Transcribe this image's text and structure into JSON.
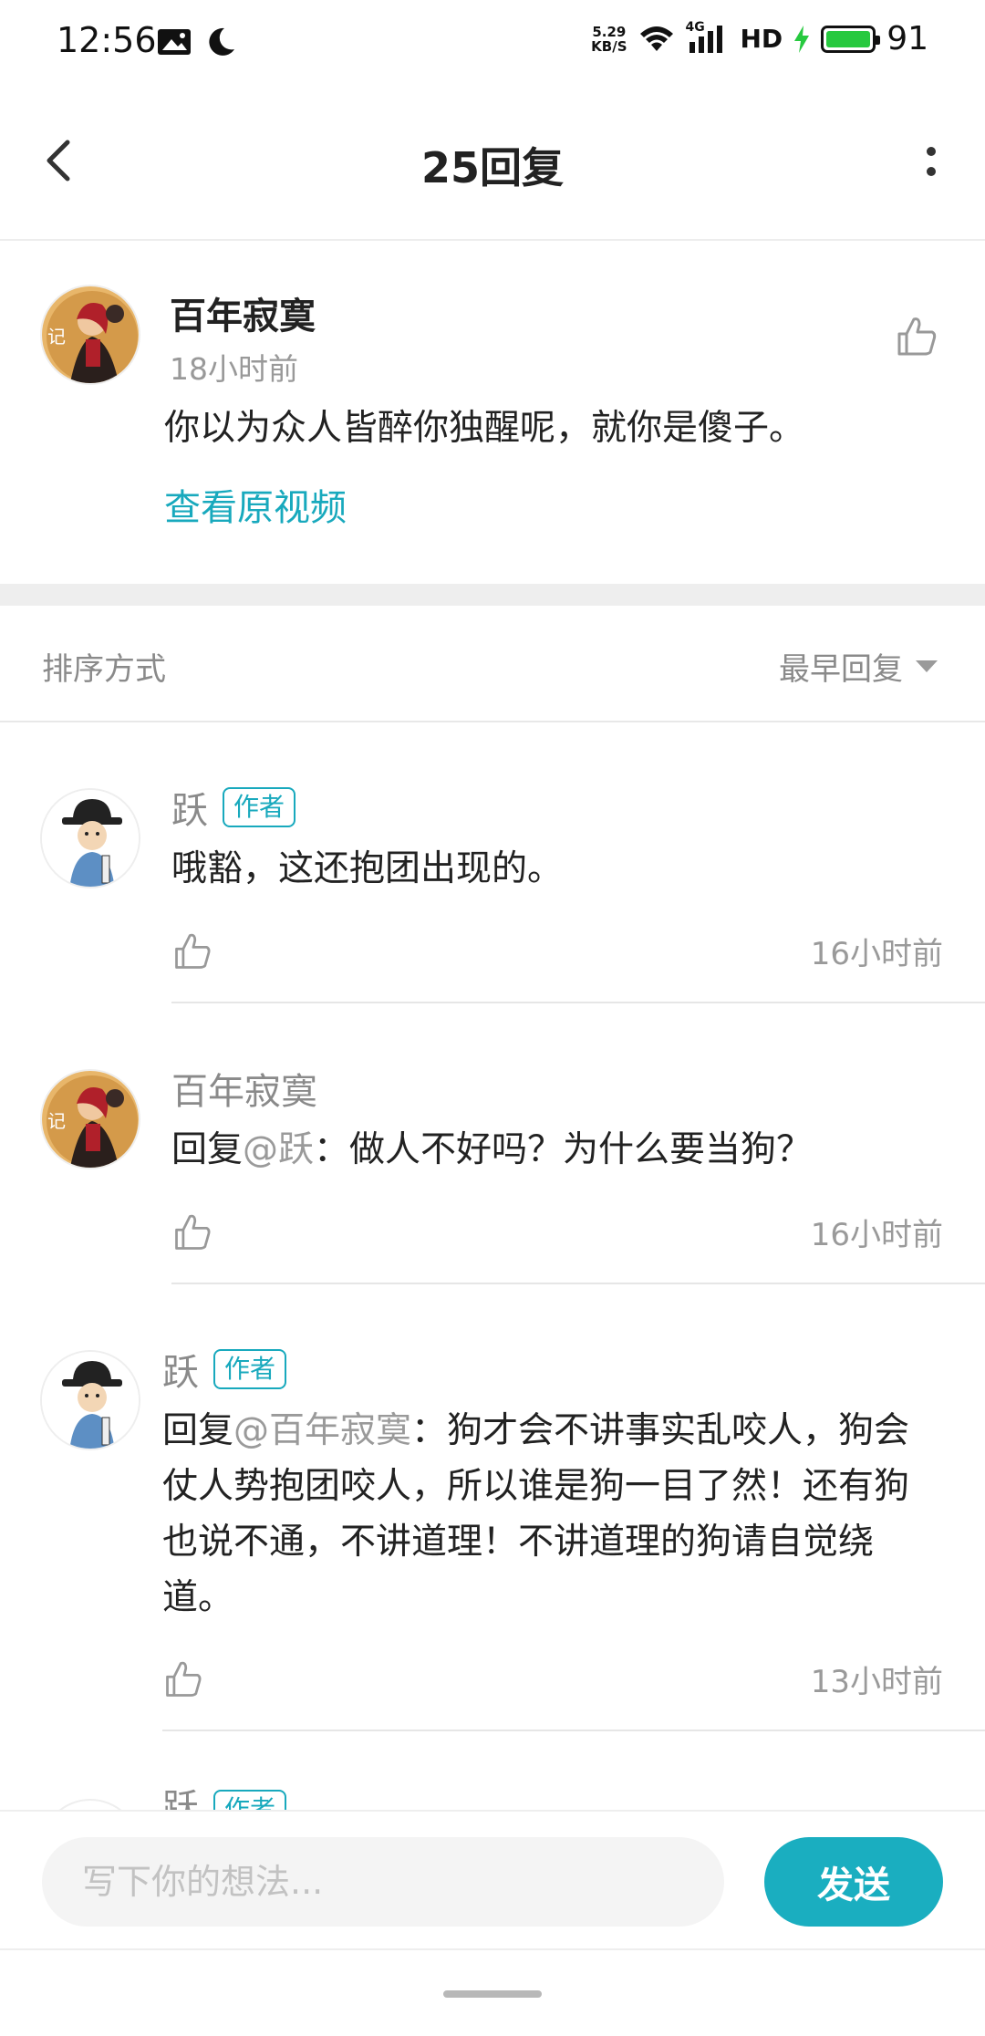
{
  "status_bar": {
    "time": "12:56",
    "net_speed_value": "5.29",
    "net_speed_unit": "KB/S",
    "network_type": "4G",
    "hd": "HD",
    "battery": "91",
    "battery_color": "#27c93f"
  },
  "header": {
    "title": "25回复"
  },
  "main_comment": {
    "author": "百年寂寞",
    "time": "18小时前",
    "text": "你以为众人皆醉你独醒呢，就你是傻子。",
    "view_video_link": "查看原视频"
  },
  "sort": {
    "label": "排序方式",
    "value": "最早回复"
  },
  "replies": [
    {
      "author": "跃",
      "tag": "作者",
      "mention": "",
      "text": "哦豁，这还抱团出现的。",
      "time": "16小时前"
    },
    {
      "author": "百年寂寞",
      "tag": "",
      "reply_prefix": "回复",
      "mention": "@跃",
      "text": "：做人不好吗？为什么要当狗？",
      "time": "16小时前"
    },
    {
      "author": "跃",
      "tag": "作者",
      "reply_prefix": "回复",
      "mention": "@百年寂寞",
      "text": "：狗才会不讲事实乱咬人，狗会仗人势抱团咬人，所以谁是狗一目了然！还有狗也说不通，不讲道理！不讲道理的狗请自觉绕道。",
      "time": "13小时前"
    },
    {
      "author": "跃",
      "tag": "作者"
    }
  ],
  "input": {
    "placeholder": "写下你的想法...",
    "send_label": "发送"
  },
  "colors": {
    "accent": "#18a9bd",
    "send_button": "#1aaec0"
  }
}
